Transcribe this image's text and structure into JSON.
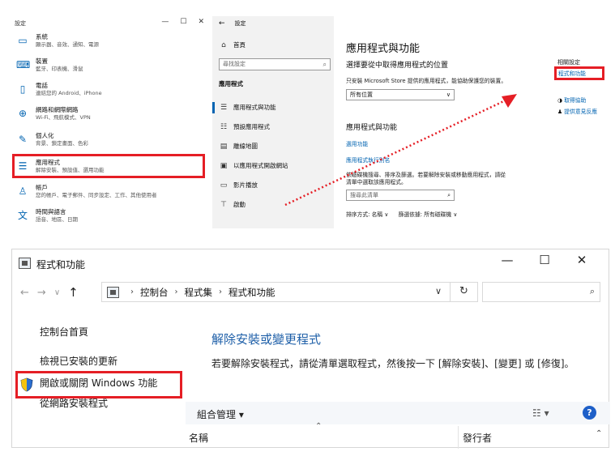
{
  "settings_home": {
    "title": "設定",
    "controls": [
      "—",
      "☐",
      "✕"
    ],
    "categories": [
      {
        "name": "系統",
        "desc": "顯示器、音效、通知、電源",
        "icon": "monitor-icon"
      },
      {
        "name": "裝置",
        "desc": "藍牙、印表機、滑鼠",
        "icon": "keyboard-icon"
      },
      {
        "name": "電話",
        "desc": "連結您的 Android、iPhone",
        "icon": "phone-icon"
      },
      {
        "name": "網路和網際網路",
        "desc": "Wi-Fi、飛航模式、VPN",
        "icon": "globe-icon"
      },
      {
        "name": "個人化",
        "desc": "背景、鎖定畫面、色彩",
        "icon": "brush-icon"
      },
      {
        "name": "應用程式",
        "desc": "解除安裝、預設值、選用功能",
        "icon": "apps-list-icon"
      },
      {
        "name": "帳戶",
        "desc": "您的帳戶、電子郵件、同步設定、工作、其他使用者",
        "icon": "person-icon"
      },
      {
        "name": "時間與語言",
        "desc": "語音、地區、日期",
        "icon": "time-language-icon"
      }
    ]
  },
  "settings_apps": {
    "back": "←",
    "window_title": "設定",
    "home": "首頁",
    "search_placeholder": "尋找設定",
    "section": "應用程式",
    "nav": [
      "應用程式與功能",
      "預設應用程式",
      "離線地圖",
      "以應用程式開啟網站",
      "影片播放",
      "啟動"
    ],
    "page_title": "應用程式與功能",
    "choose_heading": "選擇要從中取得應用程式的位置",
    "choose_desc": "只安裝 Microsoft Store 提供的應用程式，能協助保護您的裝置。",
    "location_value": "所有位置",
    "apps_heading": "應用程式與功能",
    "optional_features": "選用功能",
    "app_aliases": "應用程式執行別名",
    "search_desc_line1": "依磁碟機搜尋、排序及篩選。若要解除安裝或移動應用程式，請從",
    "search_desc_line2": "清單中選取該應用程式。",
    "search_list_placeholder": "搜尋此清單",
    "sort_label": "排序方式: 名稱",
    "filter_label": "篩選依據: 所有磁碟機",
    "related_title": "相關設定",
    "related_link": "程式和功能",
    "get_help": "取得協助",
    "feedback": "提供意見反應"
  },
  "control_panel": {
    "title": "程式和功能",
    "controls": [
      "—",
      "☐",
      "✕"
    ],
    "nav_back": "←",
    "nav_forward": "→",
    "nav_recent": "∨",
    "nav_up": "↑",
    "address": [
      "控制台",
      "程式集",
      "程式和功能"
    ],
    "address_sep": "›",
    "address_dropdown": "∨",
    "refresh": "↻",
    "search_icon": "⌕",
    "left_links": [
      "控制台首頁",
      "檢視已安裝的更新",
      "開啟或關閉 Windows 功能",
      "從網路安裝程式"
    ],
    "heading": "解除安裝或變更程式",
    "description": "若要解除安裝程式，請從清單選取程式，然後按一下 [解除安裝]、[變更] 或 [修復]。",
    "organize": "組合管理 ▾",
    "view_icon": "☷ ▾",
    "help": "?",
    "col_sort": "⌃",
    "col_name": "名稱",
    "col_publisher": "發行者",
    "scroll_up": "⌃"
  }
}
